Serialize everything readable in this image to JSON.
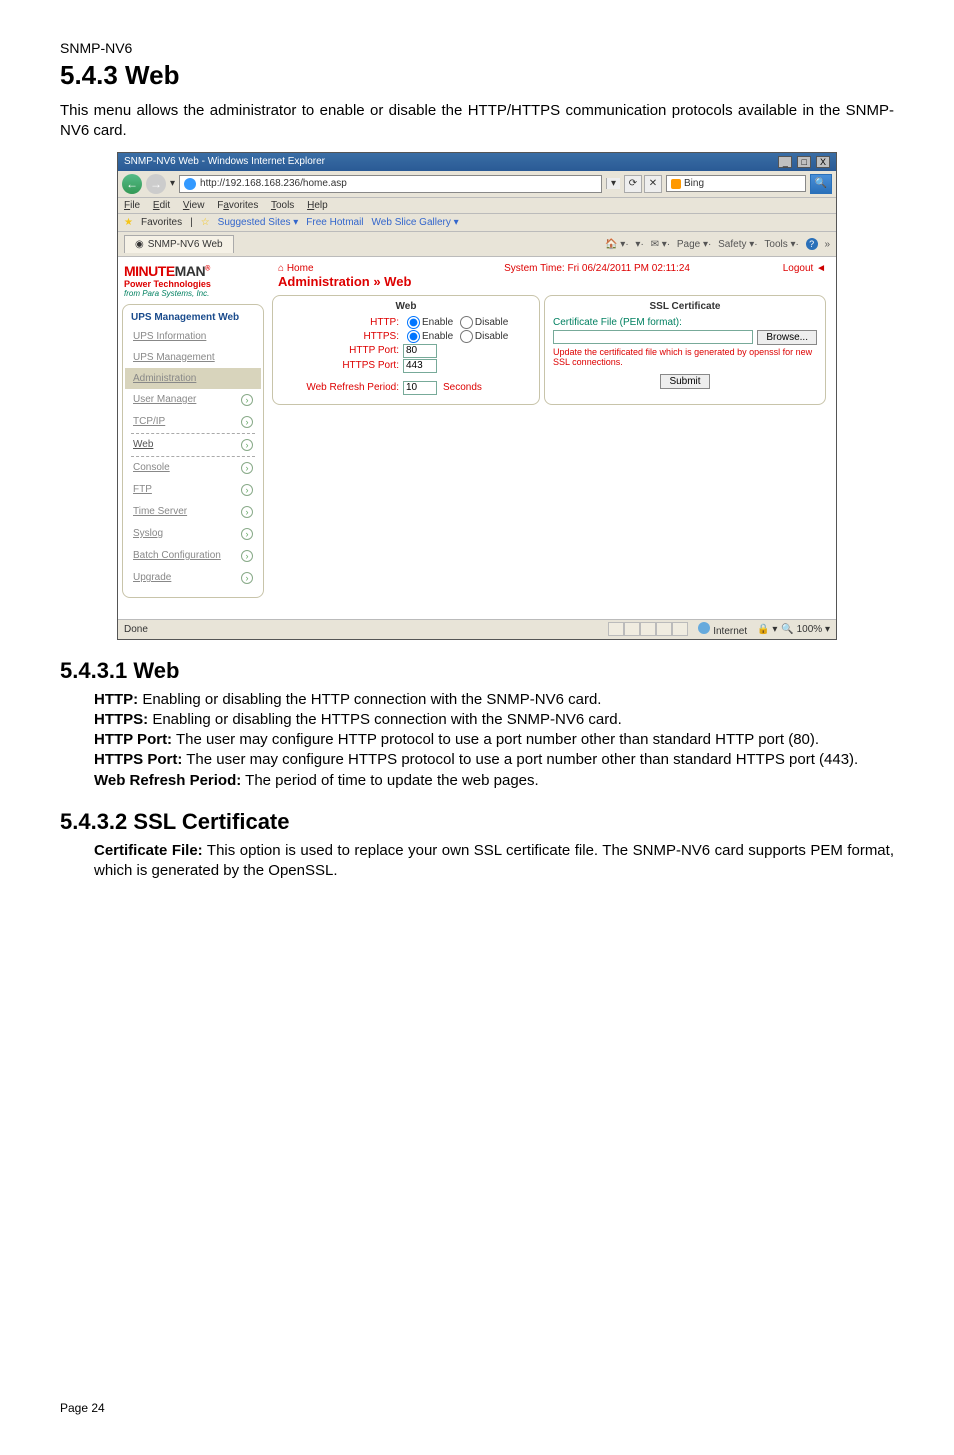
{
  "doc": {
    "header": "SNMP-NV6",
    "h1": "5.4.3 Web",
    "intro": "This menu allows the administrator to enable or disable the HTTP/HTTPS communication protocols available in the SNMP-NV6 card.",
    "h2a": "5.4.3.1 Web",
    "defs_a": [
      {
        "term": "HTTP:",
        "text": " Enabling or disabling the HTTP connection with the SNMP-NV6 card."
      },
      {
        "term": "HTTPS:",
        "text": " Enabling or disabling the HTTPS connection with the SNMP-NV6 card."
      },
      {
        "term": "HTTP Port:",
        "text": " The user may configure HTTP protocol to use a port number other than standard HTTP port (80)."
      },
      {
        "term": "HTTPS Port:",
        "text": " The user may configure HTTPS protocol to use a port number other than standard HTTPS port (443)."
      },
      {
        "term": "Web Refresh Period:",
        "text": " The period of time to update the web pages."
      }
    ],
    "h2b": "5.4.3.2 SSL Certificate",
    "defs_b": [
      {
        "term": "Certificate File:",
        "text": " This option is used to replace your own SSL certificate file. The SNMP-NV6 card supports PEM format, which is generated by the OpenSSL."
      }
    ],
    "footer": "Page 24"
  },
  "ie": {
    "title": "SNMP-NV6 Web - Windows Internet Explorer",
    "window_btns": {
      "min": "_",
      "max": "□",
      "close": "X"
    },
    "url": "http://192.168.168.236/home.asp",
    "search_placeholder": "Bing",
    "menus": [
      "File",
      "Edit",
      "View",
      "Favorites",
      "Tools",
      "Help"
    ],
    "fav_label": "Favorites",
    "fav_links": [
      "Suggested Sites ▾",
      "Free Hotmail",
      "Web Slice Gallery ▾"
    ],
    "tab_label": "SNMP-NV6 Web",
    "cmdbar": [
      "🏠 ▾",
      "▾",
      "✉ ▾",
      "Page ▾",
      "Safety ▾",
      "Tools ▾"
    ],
    "status_done": "Done",
    "status_zone": "Internet",
    "status_protected": "",
    "status_zoom": "100%"
  },
  "app": {
    "brand_a": "MINUTE",
    "brand_b": "MAN",
    "brand_line2": "Power Technologies",
    "brand_line3": "from Para Systems, Inc.",
    "sb_title": "UPS Management Web",
    "sb_top": [
      "UPS Information",
      "UPS Management",
      "Administration"
    ],
    "sb_items": [
      "User Manager",
      "TCP/IP",
      "Web",
      "Console",
      "FTP",
      "Time Server",
      "Syslog",
      "Batch Configuration",
      "Upgrade"
    ],
    "crumb_home": "Home",
    "crumb_path": "Administration » Web",
    "systime": "System Time: Fri 06/24/2011 PM 02:11:24",
    "logout": "Logout",
    "web_panel": {
      "title": "Web",
      "http_lbl": "HTTP:",
      "https_lbl": "HTTPS:",
      "enable": "Enable",
      "disable": "Disable",
      "http_port_lbl": "HTTP Port:",
      "http_port_val": "80",
      "https_port_lbl": "HTTPS Port:",
      "https_port_val": "443",
      "refresh_lbl": "Web Refresh Period:",
      "refresh_val": "10",
      "seconds": "Seconds"
    },
    "ssl_panel": {
      "title": "SSL Certificate",
      "cert_lbl": "Certificate File (PEM format):",
      "browse": "Browse...",
      "note": "Update the certificated file which is generated by openssl for new SSL connections.",
      "submit": "Submit"
    }
  }
}
